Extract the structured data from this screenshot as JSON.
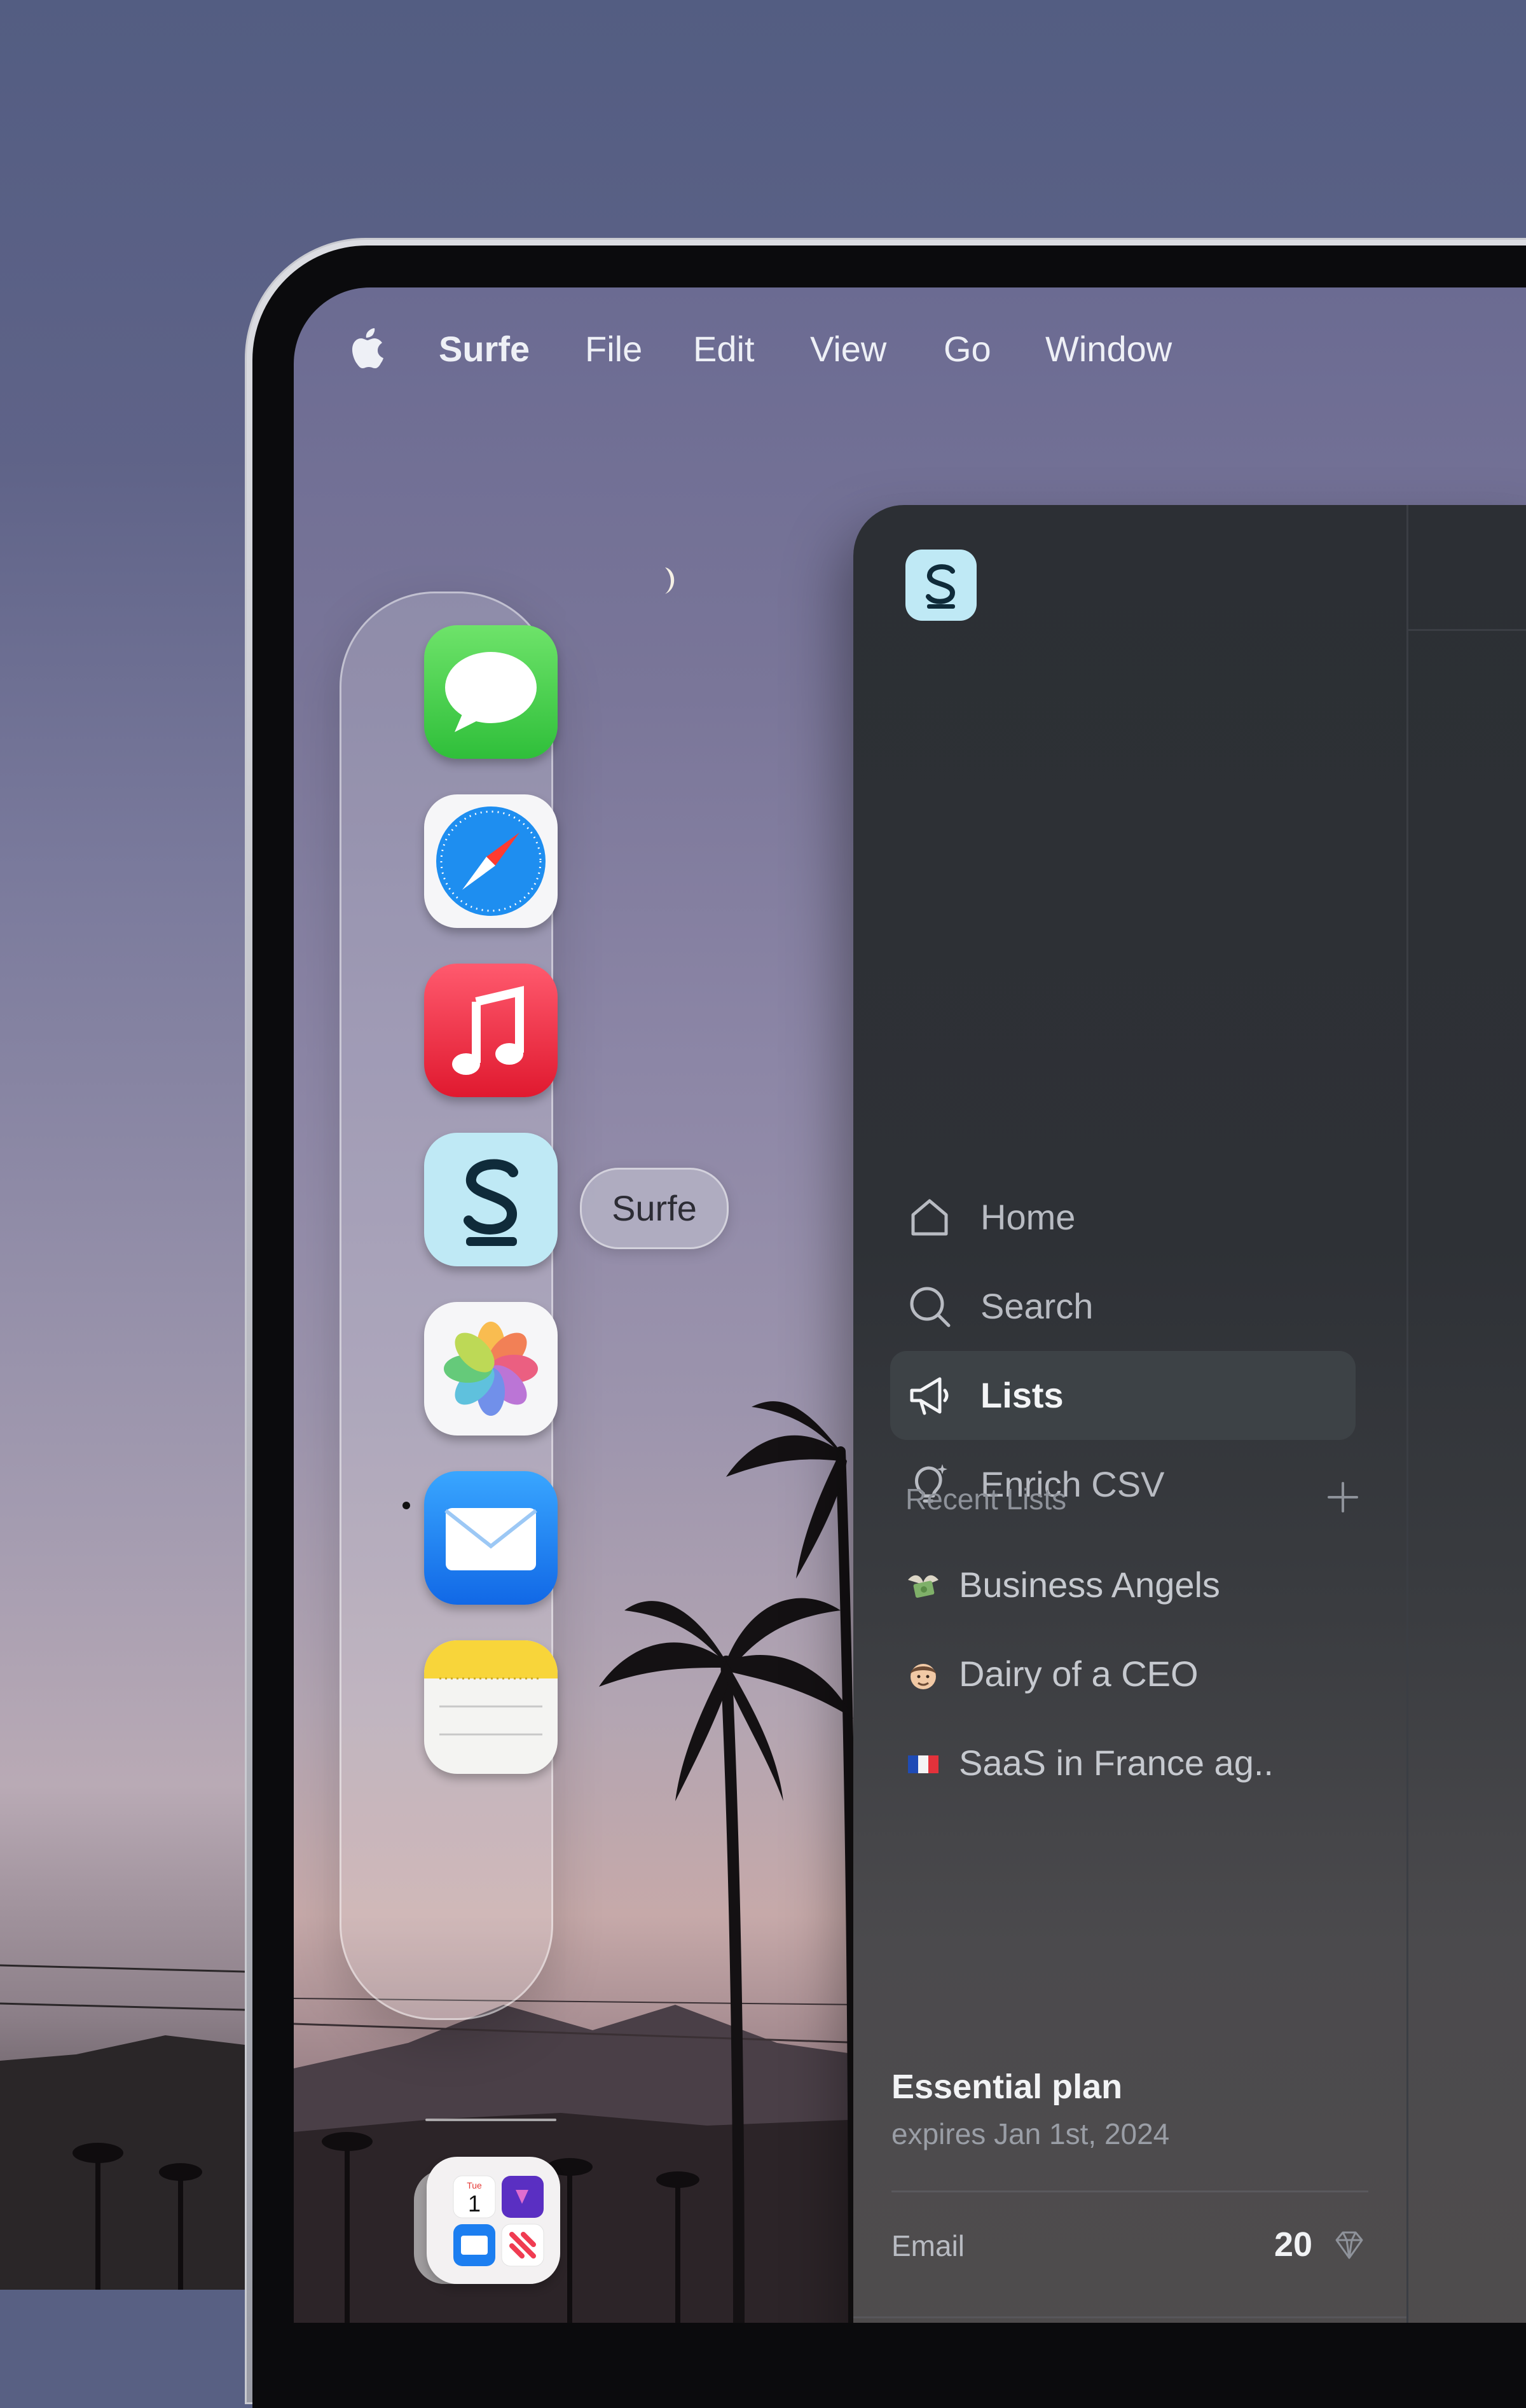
{
  "menubar": {
    "app_name": "Surfe",
    "items": [
      "File",
      "Edit",
      "View",
      "Go",
      "Window"
    ]
  },
  "dock": {
    "apps": [
      {
        "name": "Messages",
        "icon": "messages-icon"
      },
      {
        "name": "Safari",
        "icon": "safari-icon"
      },
      {
        "name": "Music",
        "icon": "music-icon"
      },
      {
        "name": "Surfe",
        "icon": "surfe-icon",
        "running": true
      },
      {
        "name": "Photos",
        "icon": "photos-icon"
      },
      {
        "name": "Mail",
        "icon": "mail-icon"
      },
      {
        "name": "Notes",
        "icon": "notes-icon"
      }
    ],
    "folder_icon": "apps-folder-icon",
    "folder_calendar_day_label": "Tue",
    "folder_calendar_date": "1",
    "tooltip": "Surfe"
  },
  "sidebar": {
    "nav": [
      {
        "label": "Home",
        "icon": "home-icon",
        "active": false
      },
      {
        "label": "Search",
        "icon": "search-icon",
        "active": false
      },
      {
        "label": "Lists",
        "icon": "megaphone-icon",
        "active": true
      },
      {
        "label": "Enrich CSV",
        "icon": "lightbulb-icon",
        "active": false
      }
    ],
    "recent_title": "Recent Lists",
    "recent_lists": [
      {
        "emoji": "money-with-wings-icon",
        "label": "Business Angels"
      },
      {
        "emoji": "man-face-icon",
        "label": "Dairy of a CEO"
      },
      {
        "emoji": "france-flag-icon",
        "label": "SaaS in France ag.."
      }
    ],
    "plan": {
      "title": "Essential plan",
      "expires": "expires Jan 1st, 2024",
      "credit_label": "Email",
      "credit_value": "20",
      "credit_icon": "diamond-icon"
    }
  },
  "colors": {
    "accent_surfe": "#bfe9f5",
    "sidebar_bg": "#2c2f34",
    "active_item_bg": "#3d4246"
  }
}
